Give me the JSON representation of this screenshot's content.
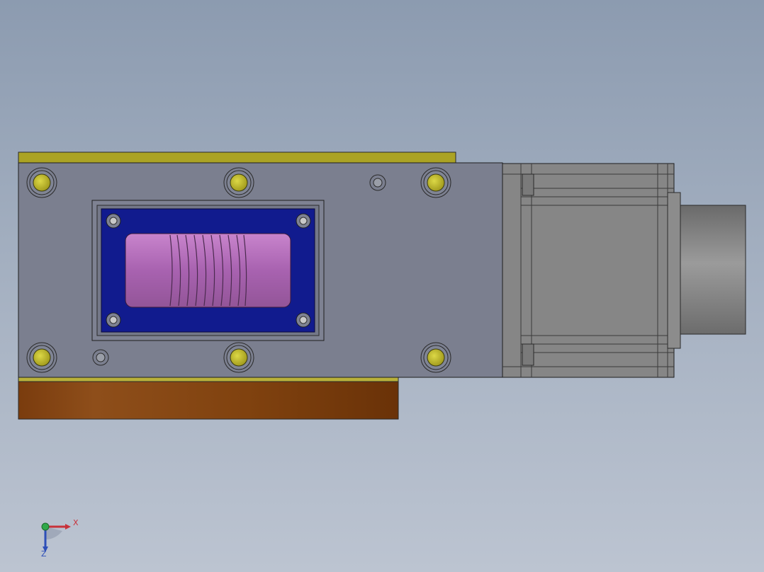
{
  "triad": {
    "x_label": "X",
    "z_label": "Z",
    "x_color": "#c8323a",
    "y_color": "#2fa84a",
    "z_color": "#2e4fb8"
  },
  "colors": {
    "background_top": "#8c9bb0",
    "background_bottom": "#bcc4d1",
    "housing": "#7b7f8f",
    "motor": "#888888",
    "yellow_rail": "#a9a222",
    "copper_plate": "#8a4e1a",
    "blue_plate": "#101a8c",
    "worm_window": "#a060a8"
  }
}
